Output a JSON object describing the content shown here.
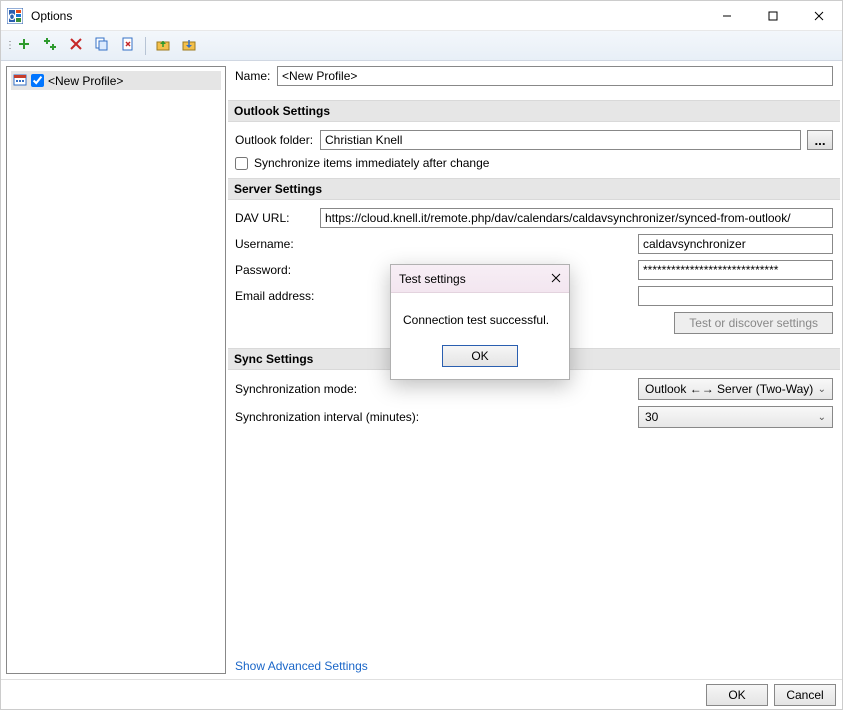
{
  "window": {
    "title": "Options"
  },
  "toolbar": {
    "icons": [
      "plus",
      "wizard",
      "x",
      "copy",
      "doc-x",
      "folder-up",
      "folder-down"
    ]
  },
  "tree": {
    "items": [
      {
        "label": "<New Profile>",
        "checked": true
      }
    ]
  },
  "form": {
    "name_label": "Name:",
    "name_value": "<New Profile>",
    "outlook": {
      "header": "Outlook Settings",
      "folder_label": "Outlook folder:",
      "folder_value": "Christian Knell",
      "browse_label": "...",
      "sync_immediate_label": "Synchronize items immediately after change",
      "sync_immediate_checked": false
    },
    "server": {
      "header": "Server Settings",
      "davurl_label": "DAV URL:",
      "davurl_value": "https://cloud.knell.it/remote.php/dav/calendars/caldavsynchronizer/synced-from-outlook/",
      "username_label": "Username:",
      "username_value": "caldavsynchronizer",
      "password_label": "Password:",
      "password_value": "*****************************",
      "email_label": "Email address:",
      "email_value": "",
      "test_label": "Test or discover settings"
    },
    "sync": {
      "header": "Sync Settings",
      "mode_label": "Synchronization mode:",
      "mode_value": "Outlook ←→ Server (Two-Way)",
      "interval_label": "Synchronization interval (minutes):",
      "interval_value": "30"
    },
    "advanced_link": "Show Advanced Settings"
  },
  "footer": {
    "ok": "OK",
    "cancel": "Cancel"
  },
  "modal": {
    "title": "Test settings",
    "message": "Connection test successful.",
    "ok": "OK"
  }
}
